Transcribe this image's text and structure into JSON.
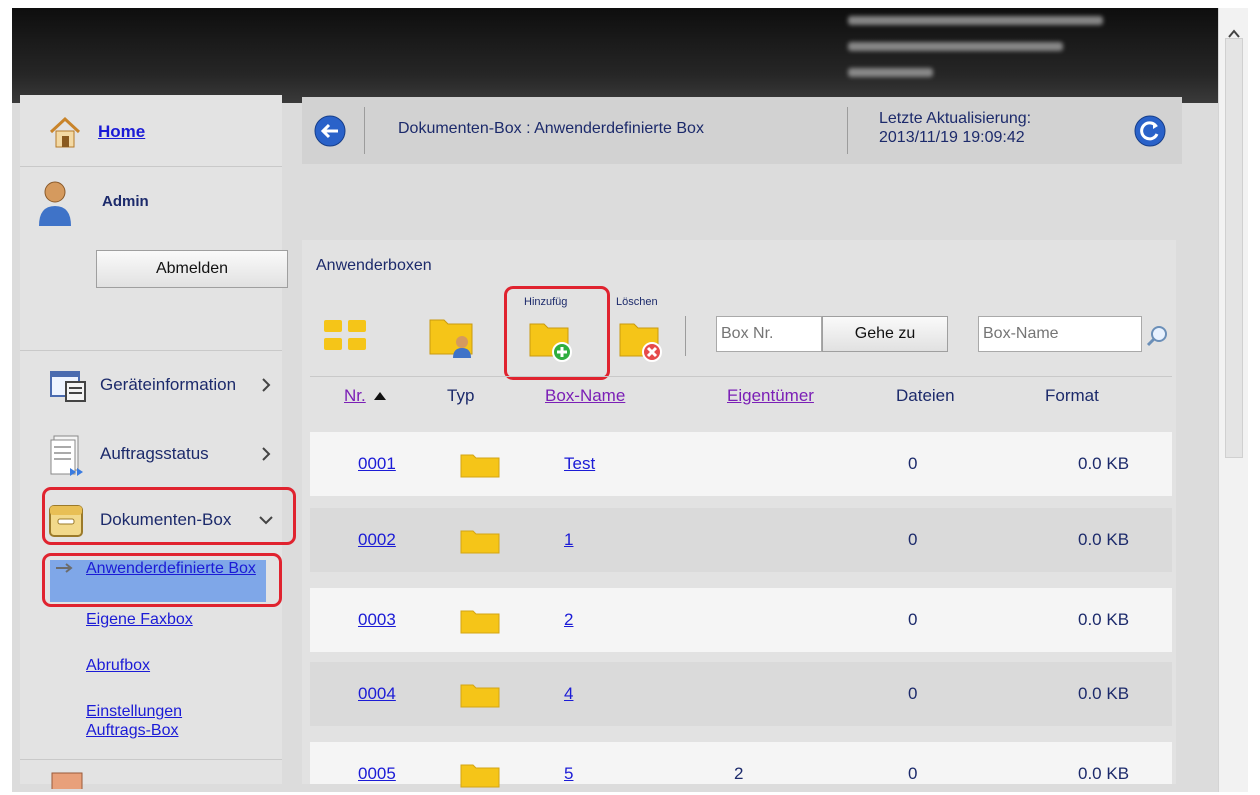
{
  "sidebar": {
    "home": "Home",
    "user": "Admin",
    "logout": "Abmelden",
    "nav": [
      {
        "label": "Geräteinformation"
      },
      {
        "label": "Auftragsstatus"
      },
      {
        "label": "Dokumenten-Box"
      }
    ],
    "subitems": [
      "Anwenderdefinierte Box",
      "Eigene Faxbox",
      "Abrufbox",
      "Einstellungen Auftrags-Box"
    ]
  },
  "header": {
    "title": "Dokumenten-Box : Anwenderdefinierte Box",
    "update_label": "Letzte Aktualisierung:",
    "update_time": "2013/11/19 19:09:42"
  },
  "main": {
    "title": "Anwenderboxen",
    "add_label": "Hinzufüg",
    "delete_label": "Löschen",
    "box_nr_placeholder": "Box Nr.",
    "goto_label": "Gehe zu",
    "box_name_placeholder": "Box-Name",
    "columns": [
      "Nr.",
      "Typ",
      "Box-Name",
      "Eigentümer",
      "Dateien",
      "Format"
    ],
    "rows": [
      {
        "nr": "0001",
        "name": "Test",
        "owner": "",
        "files": "0",
        "size": "0.0 KB"
      },
      {
        "nr": "0002",
        "name": "1",
        "owner": "",
        "files": "0",
        "size": "0.0 KB"
      },
      {
        "nr": "0003",
        "name": "2",
        "owner": "",
        "files": "0",
        "size": "0.0 KB"
      },
      {
        "nr": "0004",
        "name": "4",
        "owner": "",
        "files": "0",
        "size": "0.0 KB"
      },
      {
        "nr": "0005",
        "name": "5",
        "owner": "2",
        "files": "0",
        "size": "0.0 KB"
      }
    ]
  },
  "colors": {
    "accent_red": "#e0232f",
    "link": "#1b1bd6",
    "visited_link": "#7b1fb6",
    "text": "#1c2a6b",
    "folder": "#f5c518",
    "selected": "#7fa7e8"
  },
  "icons": [
    "home-icon",
    "user-icon",
    "device-info-icon",
    "job-status-icon",
    "document-box-icon",
    "back-icon",
    "refresh-icon",
    "folder-icon",
    "search-icon"
  ]
}
